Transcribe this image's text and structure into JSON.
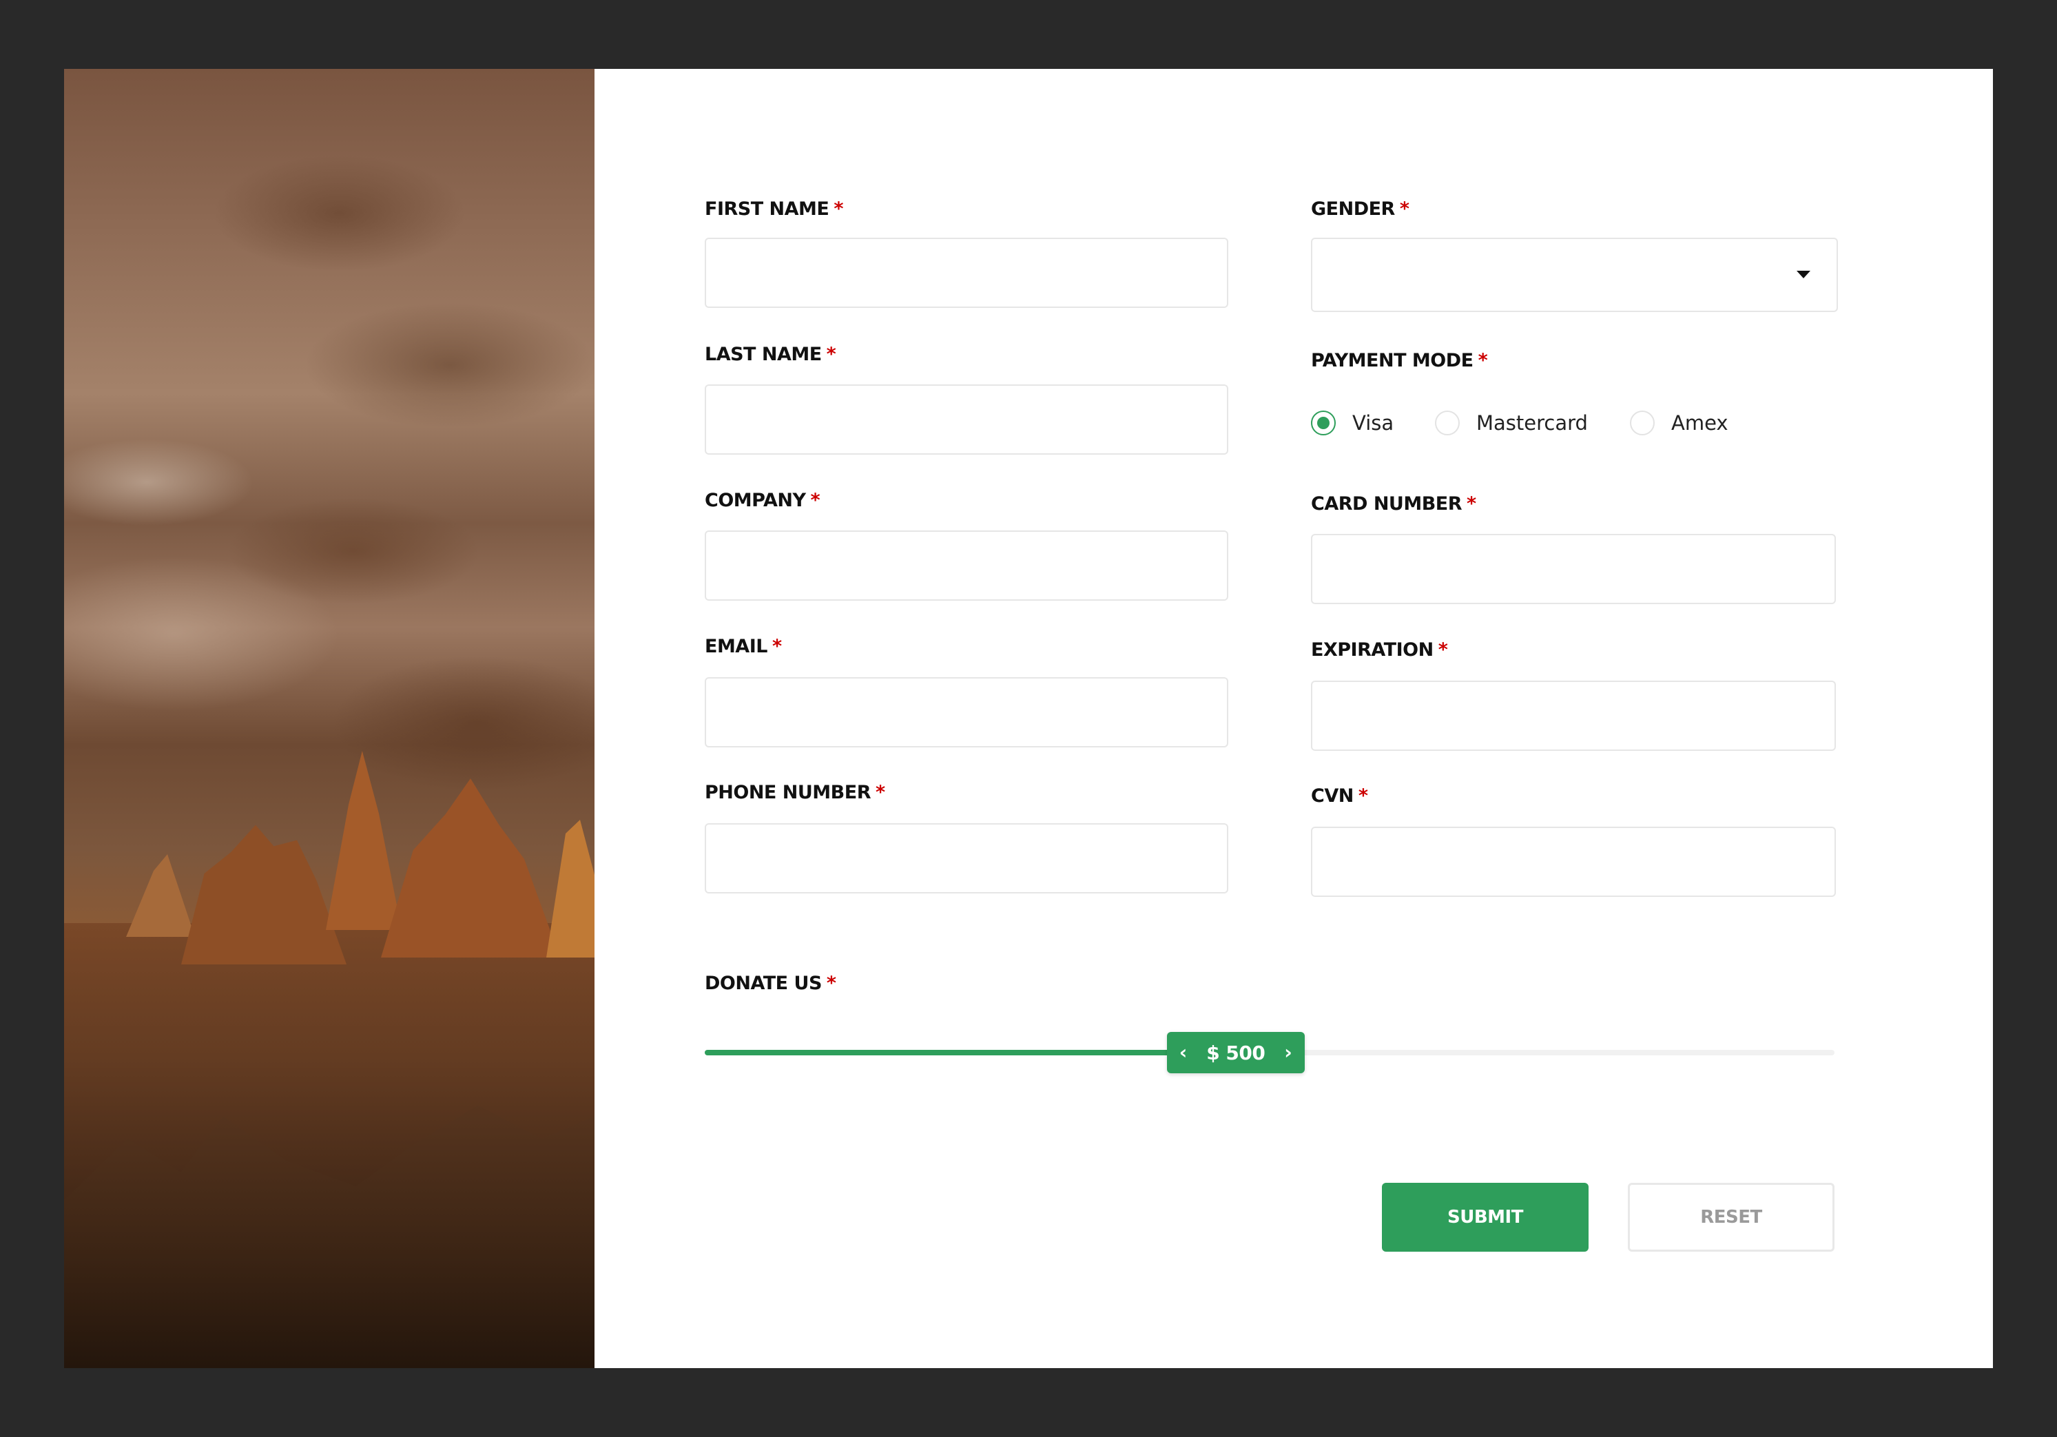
{
  "form": {
    "first_name": {
      "label": "FIRST NAME",
      "required": "*",
      "value": ""
    },
    "last_name": {
      "label": "LAST NAME",
      "required": "*",
      "value": ""
    },
    "company": {
      "label": "COMPANY",
      "required": "*",
      "value": ""
    },
    "email": {
      "label": "EMAIL",
      "required": "*",
      "value": ""
    },
    "phone": {
      "label": "PHONE NUMBER",
      "required": "*",
      "value": ""
    },
    "gender": {
      "label": "GENDER",
      "required": "*",
      "selected": ""
    },
    "payment_mode": {
      "label": "PAYMENT MODE",
      "required": "*",
      "options": [
        "Visa",
        "Mastercard",
        "Amex"
      ],
      "selected": "Visa"
    },
    "card_number": {
      "label": "CARD NUMBER",
      "required": "*",
      "value": ""
    },
    "expiration": {
      "label": "EXPIRATION",
      "required": "*",
      "value": ""
    },
    "cvn": {
      "label": "CVN",
      "required": "*",
      "value": ""
    },
    "donate": {
      "label": "DONATE US",
      "required": "*",
      "display": "$ 500",
      "prev_icon": "chevron-left-icon",
      "next_icon": "chevron-right-icon",
      "level_fraction": 0.47
    }
  },
  "buttons": {
    "submit": "SUBMIT",
    "reset": "RESET"
  },
  "colors": {
    "accent": "#2e9e5b",
    "required": "#cc0000",
    "label": "#111111",
    "background": "#292929"
  }
}
